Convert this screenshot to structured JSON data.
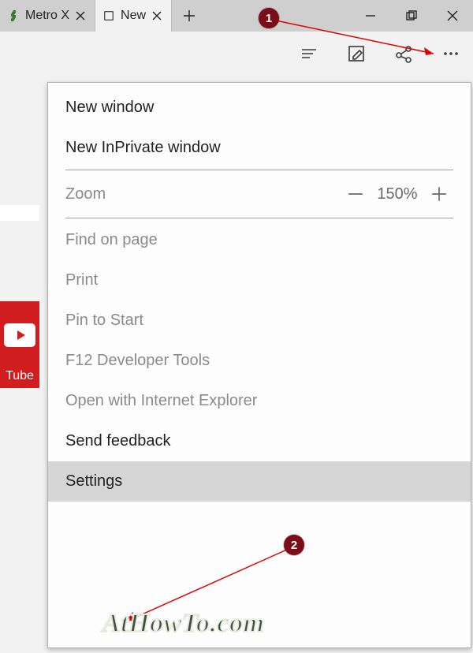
{
  "titlebar": {
    "tabs": [
      {
        "label": "Metro X",
        "favicon": "deviantart"
      },
      {
        "label": "New",
        "favicon": "page"
      }
    ]
  },
  "sidebar_tile": {
    "label": "Tube"
  },
  "menu": {
    "new_window": "New window",
    "new_inprivate": "New InPrivate window",
    "zoom_label": "Zoom",
    "zoom_value": "150%",
    "find": "Find on page",
    "print": "Print",
    "pin": "Pin to Start",
    "devtools": "F12 Developer Tools",
    "open_ie": "Open with Internet Explorer",
    "feedback": "Send feedback",
    "settings": "Settings"
  },
  "annotations": {
    "badge1": "1",
    "badge2": "2"
  },
  "watermark": "AtHowTo.com"
}
